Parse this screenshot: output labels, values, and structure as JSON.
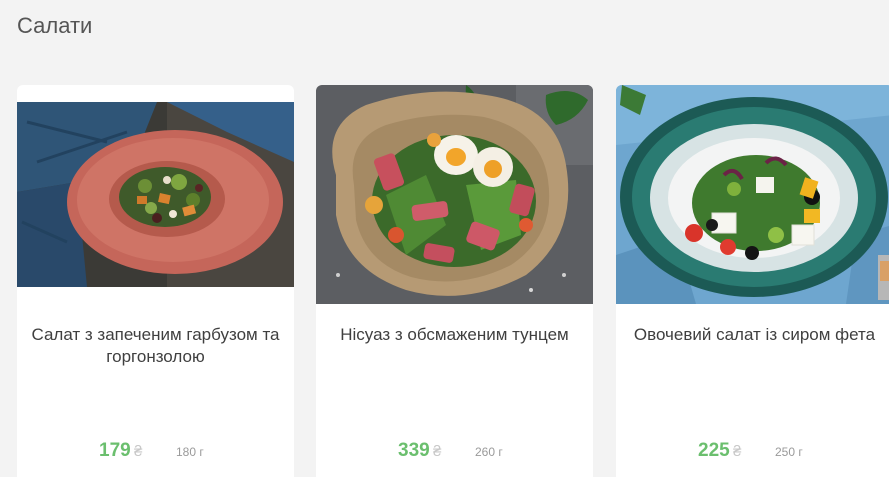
{
  "section": {
    "title": "Салати"
  },
  "currency_symbol": "₴",
  "colors": {
    "price": "#6bbf6e",
    "background": "#f3f3f3",
    "card": "#ffffff"
  },
  "cards": [
    {
      "name": "Салат з запеченим гарбузом та горгонзолою",
      "price": "179",
      "weight": "180 г",
      "image": "pumpkin-salad-photo"
    },
    {
      "name": "Нісуаз з обсмаженим тунцем",
      "price": "339",
      "weight": "260 г",
      "image": "nicoise-tuna-salad-photo"
    },
    {
      "name": "Овочевий салат із сиром фета",
      "price": "225",
      "weight": "250 г",
      "image": "greek-feta-salad-photo"
    }
  ]
}
